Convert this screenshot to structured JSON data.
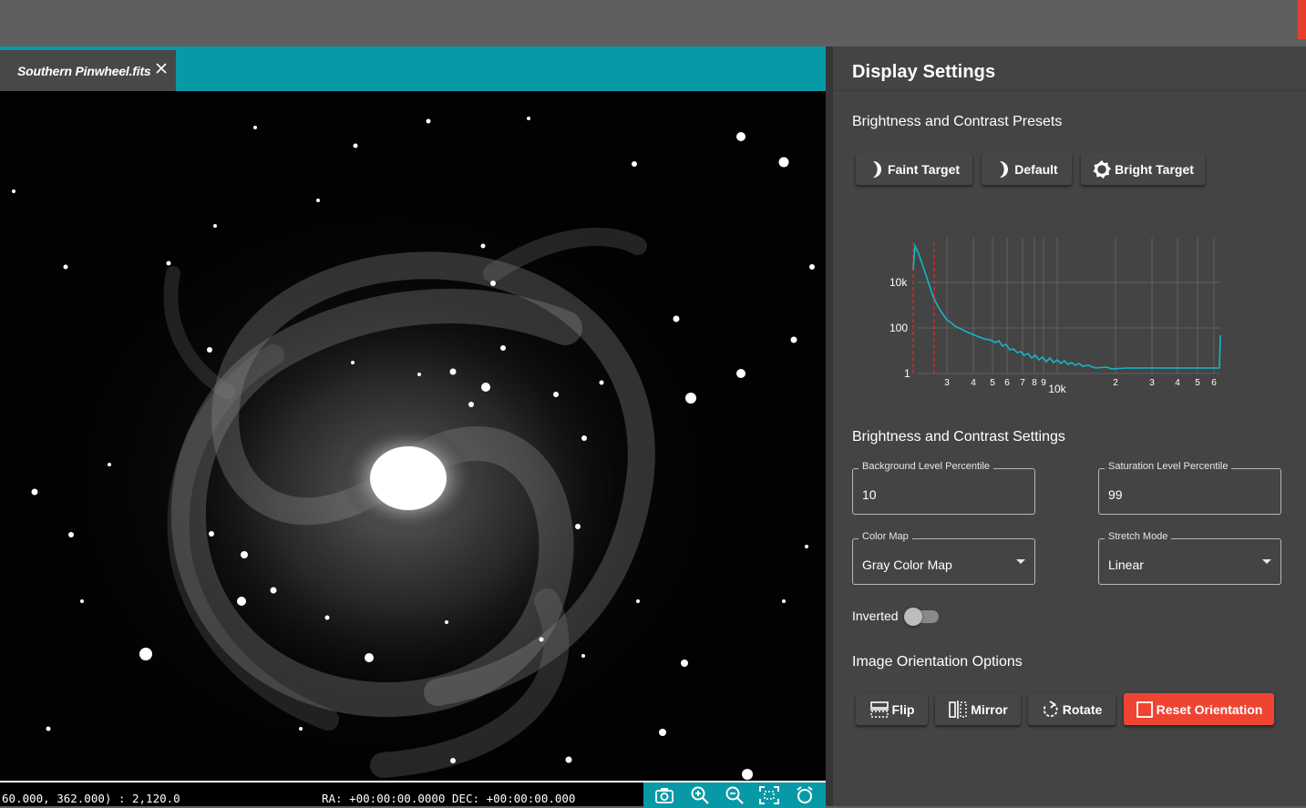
{
  "tab": {
    "filename": "Southern Pinwheel.fits"
  },
  "status": {
    "coord": "60.000, 362.000) : 2,120.0",
    "radec": "RA: +00:00:00.0000 DEC: +00:00:00.000"
  },
  "viewer_tools": [
    "camera-icon",
    "zoom-in-icon",
    "zoom-out-icon",
    "fit-screen-icon",
    "reset-zoom-icon"
  ],
  "panel": {
    "title": "Display Settings",
    "presets_title": "Brightness and Contrast Presets",
    "presets": [
      {
        "label": "Faint Target",
        "icon": "half-moon-icon"
      },
      {
        "label": "Default",
        "icon": "half-moon-icon"
      },
      {
        "label": "Bright Target",
        "icon": "sun-icon"
      }
    ],
    "settings_title": "Brightness and Contrast Settings",
    "background_level": {
      "label": "Background Level Percentile",
      "value": "10"
    },
    "saturation_level": {
      "label": "Saturation Level Percentile",
      "value": "99"
    },
    "color_map": {
      "label": "Color Map",
      "value": "Gray Color Map"
    },
    "stretch_mode": {
      "label": "Stretch Mode",
      "value": "Linear"
    },
    "inverted": {
      "label": "Inverted",
      "on": false
    },
    "orientation_title": "Image Orientation Options",
    "orientation_buttons": [
      {
        "label": "Flip",
        "icon": "flip-icon"
      },
      {
        "label": "Mirror",
        "icon": "mirror-icon"
      },
      {
        "label": "Rotate",
        "icon": "rotate-icon"
      },
      {
        "label": "Reset Orientation",
        "icon": "reset-square-icon"
      }
    ]
  },
  "histogram": {
    "y_ticks": [
      "10k",
      "100",
      "1"
    ],
    "x_ticks": [
      "3",
      "4",
      "5",
      "6",
      "7",
      "8",
      "9",
      "10k",
      "2",
      "3",
      "4",
      "5",
      "6"
    ],
    "line_color": "#15b6c8",
    "marker_color": "#d22b2b"
  },
  "colors": {
    "accent_teal": "#0899a7",
    "reset_red": "#f04433",
    "panel_bg": "#444444"
  }
}
